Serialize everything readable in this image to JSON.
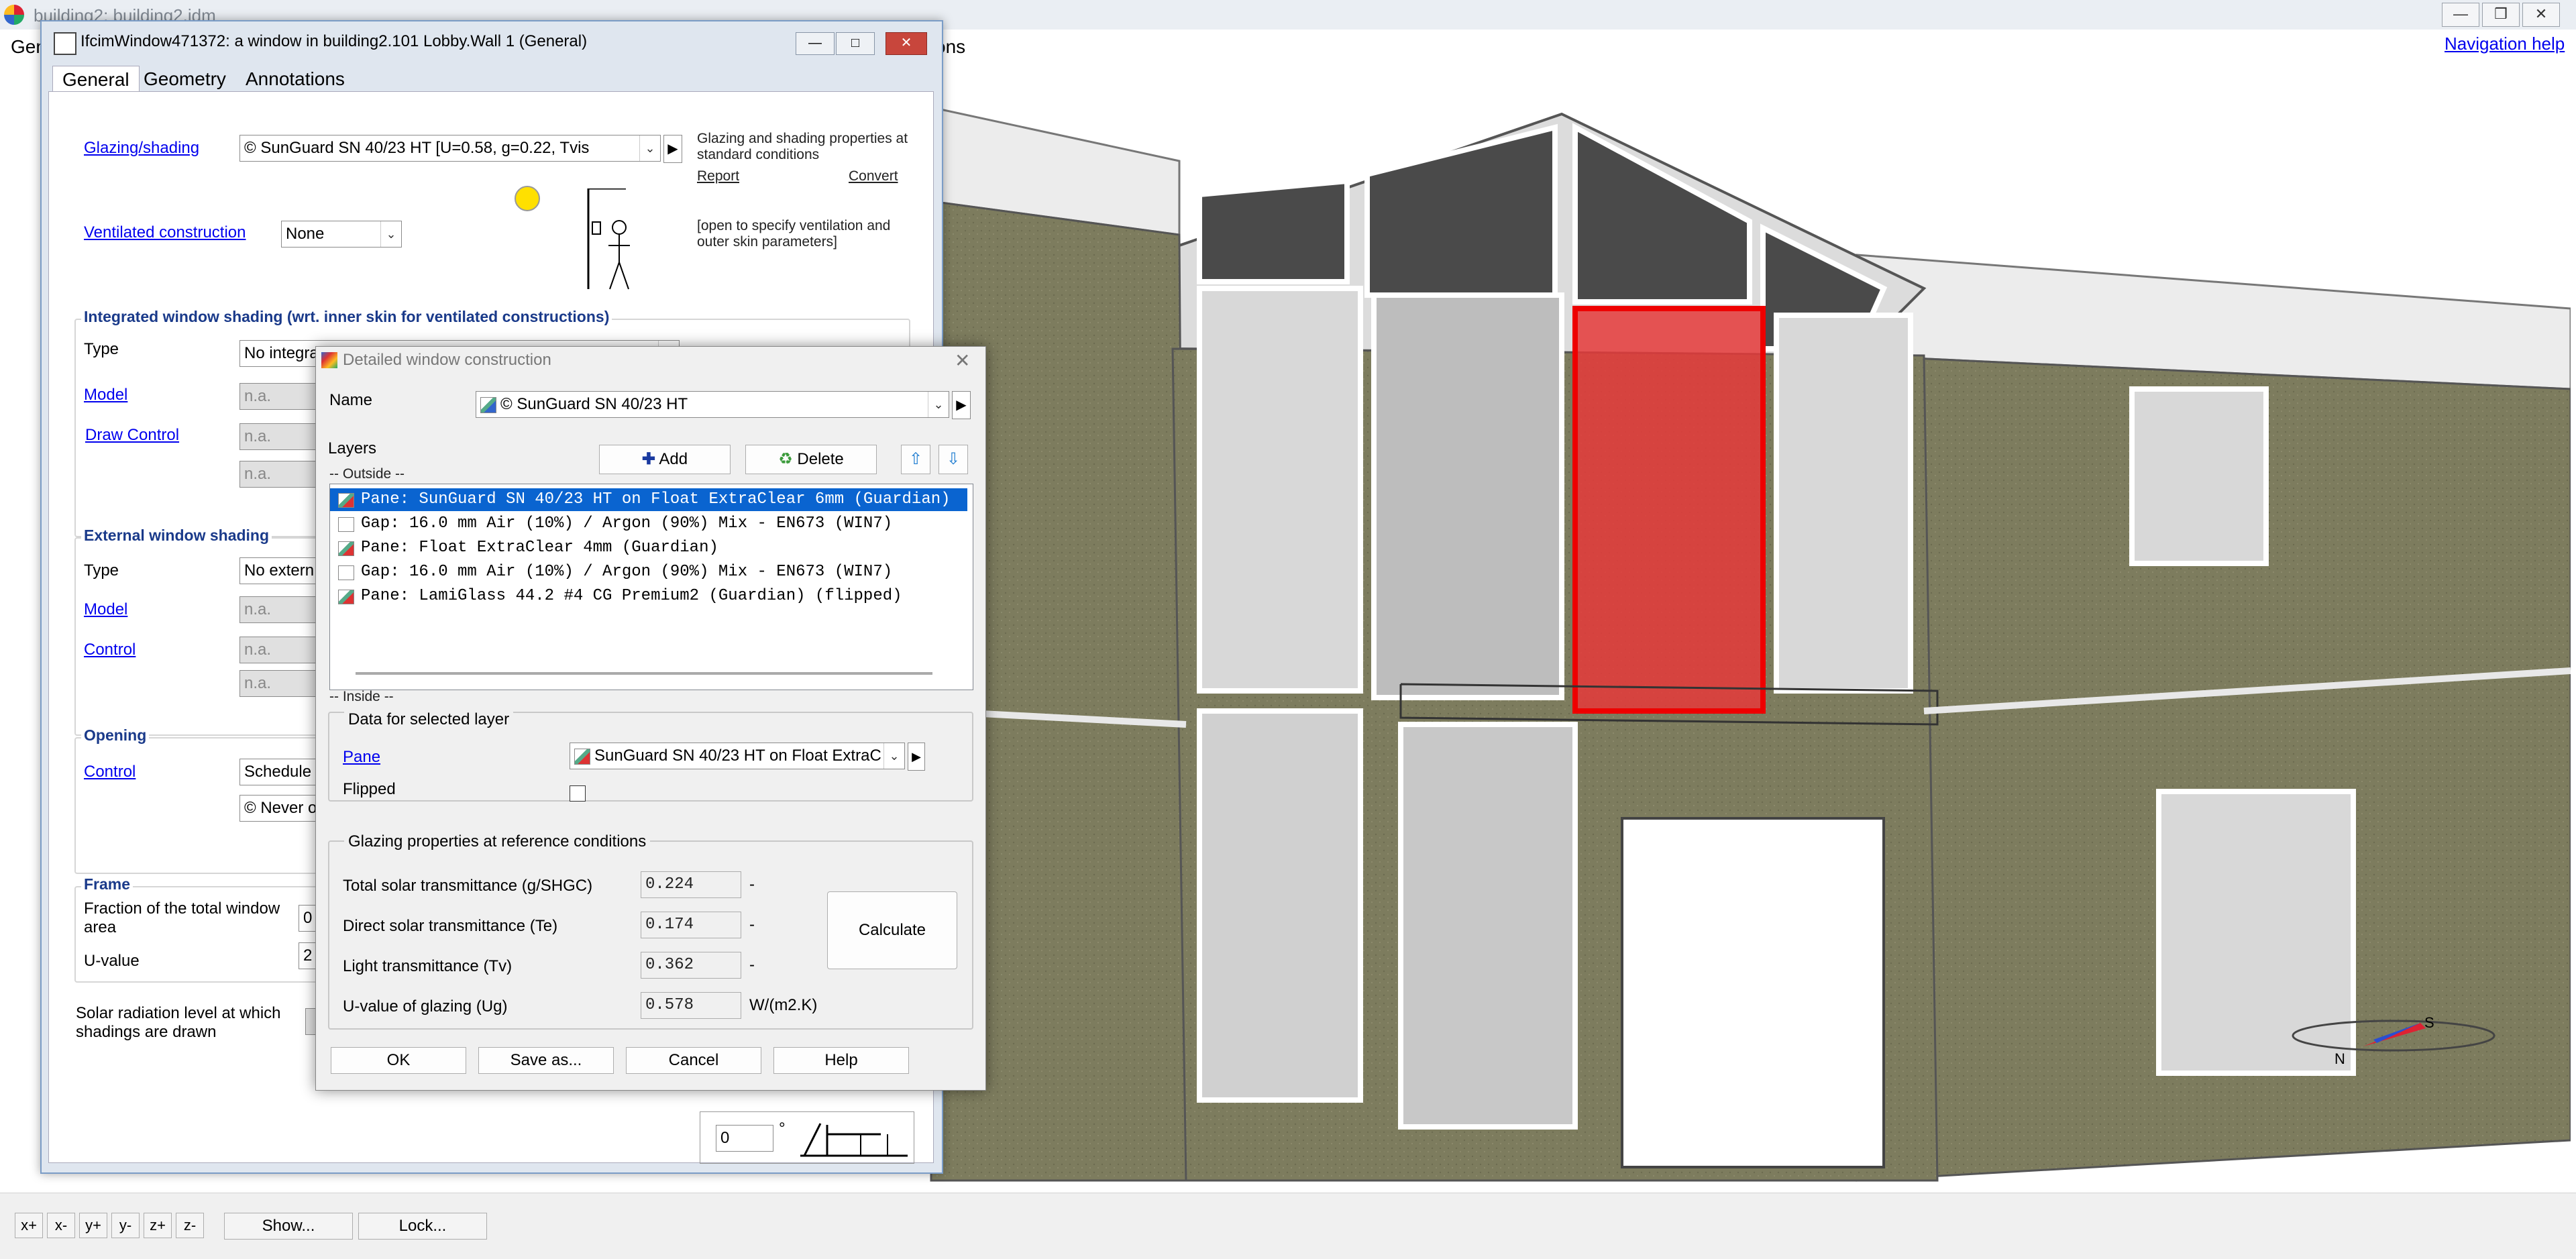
{
  "app": {
    "title": "building2: building2.idm",
    "menu_left": "Gen",
    "menu_right": "ons",
    "navigation_help": "Navigation help",
    "window_buttons": [
      "—",
      "❒",
      "✕"
    ]
  },
  "bottom_bar": {
    "nav_buttons": [
      "x+",
      "x-",
      "y+",
      "y-",
      "z+",
      "z-"
    ],
    "show_label": "Show...",
    "lock_label": "Lock..."
  },
  "compass": {
    "n": "N",
    "s": "S"
  },
  "prop_window": {
    "title": "IfcimWindow471372: a window in building2.101 Lobby.Wall 1 (General)",
    "tabs": [
      "General",
      "Geometry",
      "Annotations"
    ],
    "glazing_label": "Glazing/shading",
    "glazing_value": "© SunGuard SN 40/23 HT [U=0.58, g=0.22, Tvis",
    "glazing_desc": "Glazing and shading properties at standard conditions",
    "report_link": "Report",
    "convert_link": "Convert",
    "ventilated_label": "Ventilated construction",
    "ventilated_value": "None",
    "ventilated_desc": "[open to specify ventilation and outer skin parameters]",
    "integrated_title": "Integrated window shading (wrt. inner skin for ventilated constructions)",
    "integrated_type_label": "Type",
    "integrated_type_value": "No integrated shading",
    "integrated_model_label": "Model",
    "integrated_draw_label": "Draw Control",
    "na": "n.a.",
    "external_title": "External window shading",
    "external_type_label": "Type",
    "external_type_value": "No extern",
    "external_model_label": "Model",
    "external_control_label": "Control",
    "opening_title": "Opening",
    "opening_control_label": "Control",
    "opening_control_value": "Schedule",
    "opening_never_value": "© Never o",
    "frame_title": "Frame",
    "frame_fraction_label": "Fraction of the total window area",
    "frame_fraction_value": "0",
    "frame_u_label": "U-value",
    "frame_u_value": "2",
    "solar_label": "Solar radiation level at which shadings are drawn",
    "angle_value": "0",
    "degree": "°"
  },
  "dialog": {
    "title": "Detailed window construction",
    "name_label": "Name",
    "name_value": "© SunGuard SN 40/23 HT",
    "layers_label": "Layers",
    "add_label": "Add",
    "delete_label": "Delete",
    "outside_label": "-- Outside --",
    "inside_label": "-- Inside --",
    "layers": [
      {
        "text": "Pane: SunGuard SN 40/23 HT on Float ExtraClear 6mm (Guardian)",
        "kind": "pane",
        "selected": true
      },
      {
        "text": "Gap: 16.0 mm  Air (10%) / Argon (90%) Mix - EN673 (WIN7)",
        "kind": "gap",
        "selected": false
      },
      {
        "text": "Pane: Float ExtraClear 4mm (Guardian)",
        "kind": "pane",
        "selected": false
      },
      {
        "text": "Gap: 16.0 mm  Air (10%) / Argon (90%) Mix - EN673 (WIN7)",
        "kind": "gap",
        "selected": false
      },
      {
        "text": "Pane: LamiGlass 44.2 #4 CG Premium2 (Guardian) (flipped)",
        "kind": "pane",
        "selected": false
      }
    ],
    "selected_group_title": "Data for selected layer",
    "pane_label": "Pane",
    "pane_value": "SunGuard SN 40/23 HT on Float ExtraC",
    "flipped_label": "Flipped",
    "props_group_title": "Glazing properties at reference conditions",
    "props": [
      {
        "label": "Total solar transmittance (g/SHGC)",
        "value": "0.224",
        "unit": "-"
      },
      {
        "label": "Direct solar transmittance (Te)",
        "value": "0.174",
        "unit": "-"
      },
      {
        "label": "Light transmittance (Tv)",
        "value": "0.362",
        "unit": "-"
      },
      {
        "label": "U-value of glazing (Ug)",
        "value": "0.578",
        "unit": "W/(m2.K)"
      }
    ],
    "calculate_label": "Calculate",
    "ok_label": "OK",
    "saveas_label": "Save as...",
    "cancel_label": "Cancel",
    "help_label": "Help"
  },
  "colors": {
    "wall": "#7d7c5e",
    "glass_dark": "#4a4a4a",
    "glass_light": "#d8d8d8",
    "highlight": "#e53a3a",
    "roof": "#ececec",
    "selection": "#0a64d0"
  }
}
